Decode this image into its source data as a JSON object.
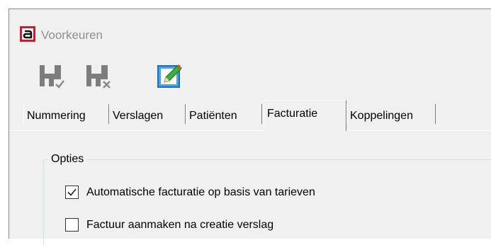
{
  "window": {
    "title": "Voorkeuren",
    "app_icon_name": "app-logo-icon",
    "brand_color": "#cc1d2b"
  },
  "toolbar": {
    "buttons": [
      {
        "icon": "save-confirm-icon",
        "enabled": false
      },
      {
        "icon": "save-cancel-icon",
        "enabled": false
      },
      {
        "icon": "edit-pencil-icon",
        "enabled": true
      }
    ]
  },
  "tabs": [
    {
      "label": "Nummering",
      "active": false
    },
    {
      "label": "Verslagen",
      "active": false
    },
    {
      "label": "Patiënten",
      "active": false
    },
    {
      "label": "Facturatie",
      "active": true
    },
    {
      "label": "Koppelingen",
      "active": false
    }
  ],
  "options_group": {
    "legend": "Opties",
    "items": [
      {
        "label": "Automatische facturatie  op basis van tarieven",
        "checked": true
      },
      {
        "label": "Factuur aanmaken na creatie verslag",
        "checked": false
      }
    ]
  }
}
